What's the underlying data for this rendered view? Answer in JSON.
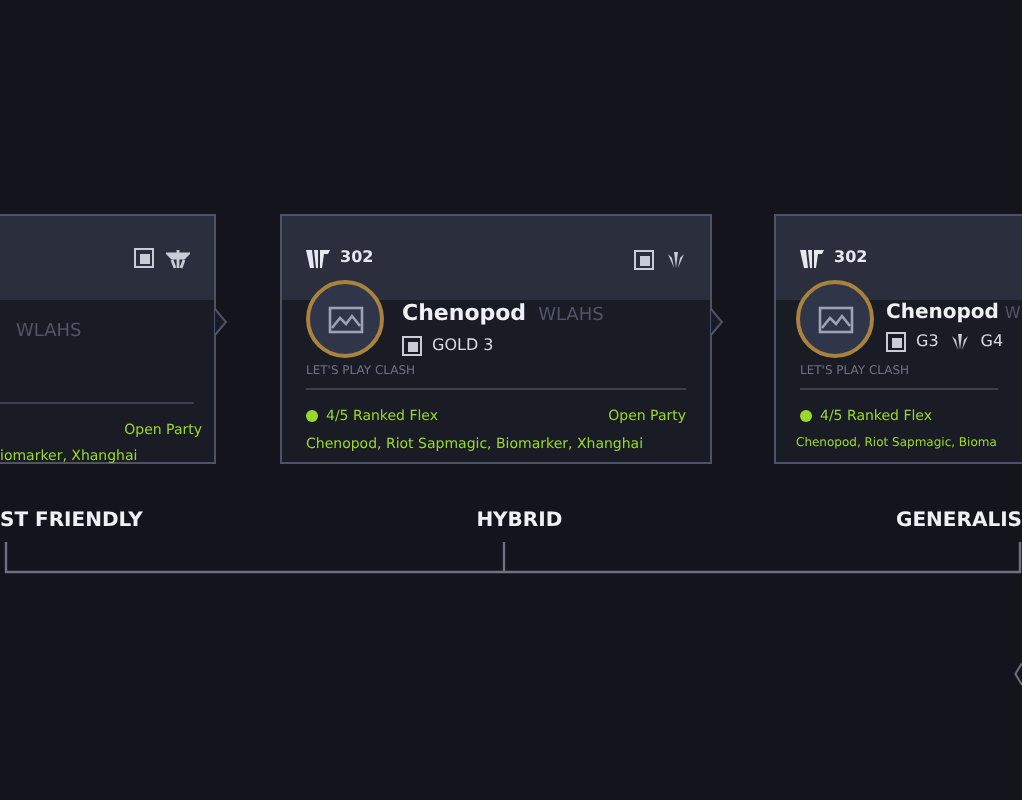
{
  "cards": [
    {
      "kind": "left_cut",
      "tag": "WLAHS",
      "party": "Open Party",
      "members": "iomarker, Xhanghai"
    },
    {
      "kind": "full",
      "team_number": "302",
      "name": "Chenopod",
      "tag": "WLAHS",
      "ranks": [
        {
          "label": "GOLD 3"
        }
      ],
      "motto": "LET'S PLAY CLASH",
      "online": true,
      "queue": "4/5 Ranked Flex",
      "party": "Open Party",
      "members": "Chenopod, Riot Sapmagic, Biomarker, Xhanghai"
    },
    {
      "kind": "right_cut",
      "team_number": "302",
      "name": "Chenopod",
      "tag": "W",
      "ranks": [
        {
          "label": "G3"
        },
        {
          "label": "G4"
        }
      ],
      "motto": "LET'S PLAY CLASH",
      "online": true,
      "queue": "4/5 Ranked Flex",
      "members": "Chenopod, Riot Sapmagic, Bioma"
    }
  ],
  "axis": {
    "labels": [
      "ST FRIENDLY",
      "HYBRID",
      "GENERALIS"
    ]
  }
}
